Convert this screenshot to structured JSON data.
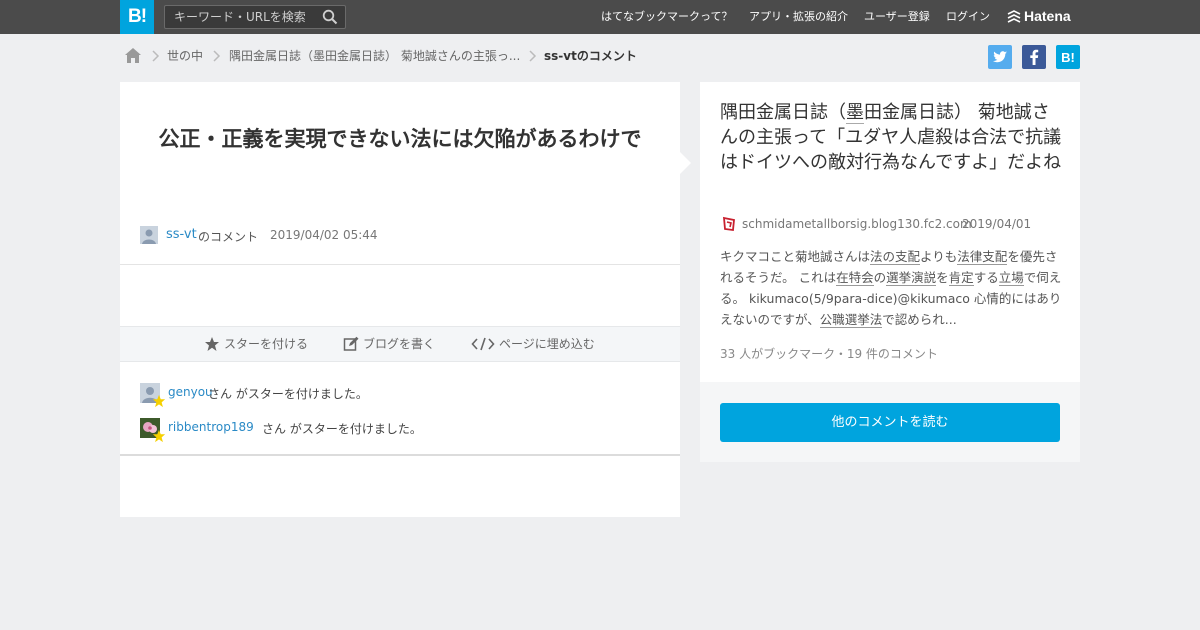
{
  "header": {
    "logo_text": "B!",
    "search_placeholder": "キーワード・URLを検索",
    "nav": [
      "はてなブックマークって？",
      "アプリ・拡張の紹介",
      "ユーザー登録",
      "ログイン"
    ],
    "brand": "Hatena",
    "colors": {
      "bar": "#4b4b4b",
      "accent": "#00a4de"
    }
  },
  "breadcrumb": {
    "items": [
      "世の中",
      "隅田金属日誌（墨田金属日誌） 菊地誠さんの主張っ...",
      "ss-vtのコメント"
    ]
  },
  "share": {
    "icons": [
      "twitter-icon",
      "facebook-icon",
      "hatena-bookmark-icon"
    ]
  },
  "comment": {
    "text": "公正・正義を実現できない法には欠陥があるわけで",
    "user": "ss-vt",
    "suffix": "のコメント",
    "date": "2019/04/02 05:44"
  },
  "actions": {
    "star": "スターを付ける",
    "blog": "ブログを書く",
    "embed": "ページに埋め込む"
  },
  "stars": [
    {
      "user": "genyou",
      "text": "さん がスターを付けました。"
    },
    {
      "user": "ribbentrop189",
      "text": "さん がスターを付けました。"
    }
  ],
  "entry": {
    "title_line1": "隅田金属日誌（",
    "title_ul": "墨",
    "title_rest": "田金属日誌） 菊地誠さんの主張って「ユダヤ人虐殺は合法で抗議はドイツへの敵対行為なんですよ」だよね",
    "site": "schmidametallborsig.blog130.fc2.com",
    "date": "2019/04/01",
    "summary": {
      "p1": "キクマコこと菊地誠さんは",
      "u1": "法の支配",
      "p2": "よりも",
      "u2": "法律支配",
      "p3": "を優先されるそうだ。 これは",
      "u3": "在特会",
      "p4": "の",
      "u4": "選挙演説",
      "p5": "を",
      "u5": "肯定",
      "p6": "する",
      "u6": "立場",
      "p7": "で伺える。 kikumaco(5/9para-dice)@kikumaco 心情的にはありえないのですが、",
      "u7": "公職選挙法",
      "p8": "で認められ..."
    },
    "counts": "33 人がブックマーク・19 件のコメント",
    "read_more": "他のコメントを読む"
  }
}
